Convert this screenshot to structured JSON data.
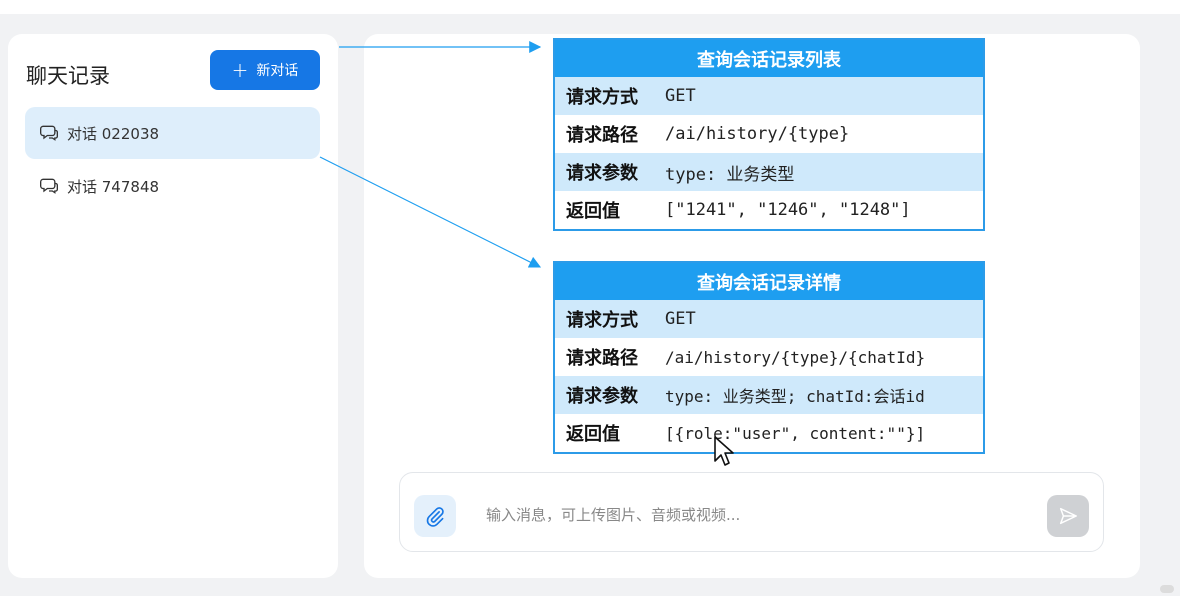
{
  "sidebar": {
    "title": "聊天记录",
    "new_chat_label": "新对话",
    "items": [
      {
        "label": "对话 022038",
        "active": true
      },
      {
        "label": "对话 747848",
        "active": false
      }
    ]
  },
  "input": {
    "placeholder": "输入消息，可上传图片、音频或视频..."
  },
  "api_list": {
    "title": "查询会话记录列表",
    "rows": [
      {
        "key": "请求方式",
        "value": "GET"
      },
      {
        "key": "请求路径",
        "value": "/ai/history/{type}"
      },
      {
        "key": "请求参数",
        "value": "type: 业务类型"
      },
      {
        "key": "返回值",
        "value": "[\"1241\", \"1246\", \"1248\"]"
      }
    ]
  },
  "api_detail": {
    "title": "查询会话记录详情",
    "rows": [
      {
        "key": "请求方式",
        "value": "GET"
      },
      {
        "key": "请求路径",
        "value": "/ai/history/{type}/{chatId}"
      },
      {
        "key": "请求参数",
        "value": "type: 业务类型; chatId:会话id"
      },
      {
        "key": "返回值",
        "value": "[{role:\"user\", content:\"\"}]"
      }
    ]
  },
  "colors": {
    "accent": "#1677e5",
    "card_header": "#1e9ef0",
    "row_highlight": "#cfe9fb",
    "active_item": "#deeefb"
  },
  "icons": {
    "plus": "plus-icon",
    "chat": "chat-bubble-icon",
    "attach": "paperclip-icon",
    "send": "send-icon"
  }
}
